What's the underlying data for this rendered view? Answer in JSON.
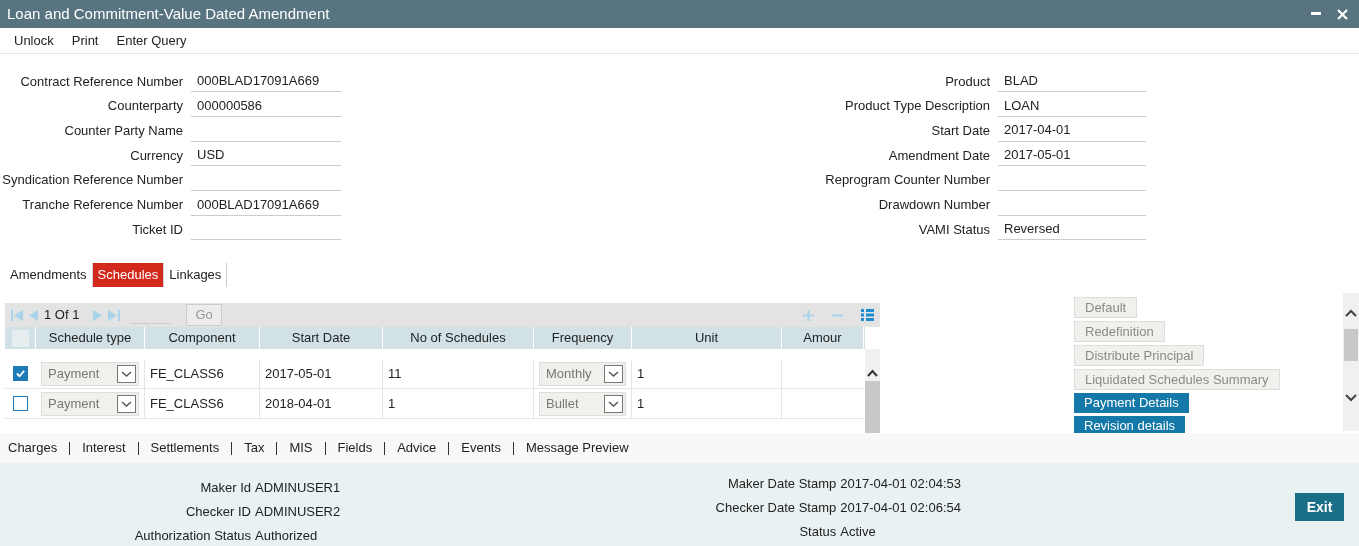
{
  "window": {
    "title": "Loan and Commitment-Value Dated Amendment"
  },
  "menu": [
    "Unlock",
    "Print",
    "Enter Query"
  ],
  "fields_left": [
    {
      "label": "Contract Reference Number",
      "value": "000BLAD17091A669"
    },
    {
      "label": "Counterparty",
      "value": "000000586"
    },
    {
      "label": "Counter Party Name"
    },
    {
      "label": "Currency",
      "value": "USD"
    },
    {
      "label": "Syndication Reference Number"
    },
    {
      "label": "Tranche Reference Number",
      "value": "000BLAD17091A669"
    },
    {
      "label": "Ticket ID"
    }
  ],
  "fields_right": [
    {
      "label": "Product",
      "value": "BLAD"
    },
    {
      "label": "Product Type Description",
      "value": "LOAN"
    },
    {
      "label": "Start Date",
      "value": "2017-04-01"
    },
    {
      "label": "Amendment Date",
      "value": "2017-05-01"
    },
    {
      "label": "Reprogram Counter Number"
    },
    {
      "label": "Drawdown Number"
    },
    {
      "label": "VAMI Status",
      "value": "Reversed"
    }
  ],
  "tabs": [
    {
      "label": "Amendments",
      "selected": false
    },
    {
      "label": "Schedules",
      "selected": true
    },
    {
      "label": "Linkages",
      "selected": false
    }
  ],
  "pager": {
    "text": "1 Of 1",
    "go": "Go"
  },
  "table": {
    "select_all": {
      "checked": false
    },
    "columns": [
      "Schedule type",
      "Component",
      "Start Date",
      "No of Schedules",
      "Frequency",
      "Unit",
      "Amour"
    ],
    "rows": [
      {
        "checked": true,
        "schedule_type": "Payment",
        "component": "FE_CLASS6",
        "start_date": "2017-05-01",
        "no_of_schedules": "11",
        "frequency": "Monthly",
        "unit": "1"
      },
      {
        "checked": false,
        "schedule_type": "Payment",
        "component": "FE_CLASS6",
        "start_date": "2018-04-01",
        "no_of_schedules": "1",
        "frequency": "Bullet",
        "unit": "1"
      }
    ]
  },
  "side_buttons": [
    {
      "label": "Default",
      "disabled": true
    },
    {
      "label": "Redefinition",
      "disabled": true
    },
    {
      "label": "Distribute Principal",
      "disabled": true
    },
    {
      "label": "Liquidated Schedules Summary",
      "disabled": true
    },
    {
      "label": "Payment Details",
      "disabled": false
    },
    {
      "label": "Revision details",
      "disabled": false
    }
  ],
  "sub_links": [
    "Charges",
    "Interest",
    "Settlements",
    "Tax",
    "MIS",
    "Fields",
    "Advice",
    "Events",
    "Message Preview"
  ],
  "footer_left": [
    {
      "label": "Maker Id",
      "value": "ADMINUSER1"
    },
    {
      "label": "Checker ID",
      "value": "ADMINUSER2"
    },
    {
      "label": "Authorization Status",
      "value": "Authorized"
    }
  ],
  "footer_right": [
    {
      "label": "Maker Date Stamp",
      "value": "2017-04-01 02:04:53"
    },
    {
      "label": "Checker Date Stamp",
      "value": "2017-04-01 02:06:54"
    },
    {
      "label": "Status",
      "value": "Active"
    }
  ],
  "exit": "Exit"
}
